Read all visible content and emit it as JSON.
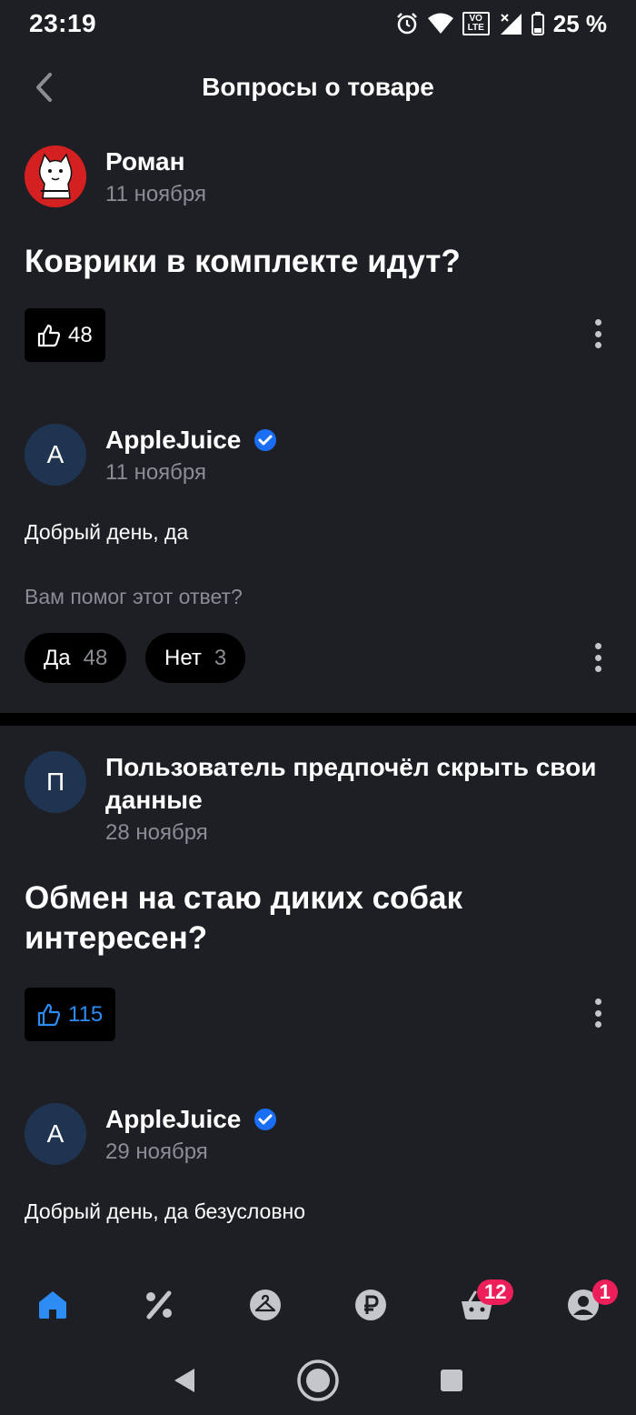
{
  "status": {
    "time": "23:19",
    "battery": "25 %",
    "network_label_top": "VO",
    "network_label_bottom": "LTE"
  },
  "header": {
    "title": "Вопросы о товаре"
  },
  "questions": [
    {
      "author": "Роман",
      "date": "11 ноября",
      "text": "Коврики в комплекте идут?",
      "likes": "48",
      "answer": {
        "avatar_letter": "A",
        "author": "AppleJuice",
        "date": "11 ноября",
        "text": "Добрый день, да",
        "helpful_question": "Вам помог этот ответ?",
        "yes_label": "Да",
        "yes_count": "48",
        "no_label": "Нет",
        "no_count": "3"
      }
    },
    {
      "avatar_letter": "П",
      "author": "Пользователь предпочёл скрыть свои данные",
      "date": "28 ноября",
      "text": "Обмен на стаю диких собак интересен?",
      "likes": "115",
      "answer": {
        "avatar_letter": "A",
        "author": "AppleJuice",
        "date": "29 ноября",
        "text": "Добрый день, да безусловно"
      }
    }
  ],
  "nav": {
    "items": [
      "home-icon",
      "percent-icon",
      "hanger-icon",
      "ruble-icon",
      "basket-icon",
      "profile-icon"
    ],
    "basket_badge": "12",
    "profile_badge": "1",
    "active_color": "#2c8cf4"
  },
  "colors": {
    "background": "#1d1f24",
    "muted": "#8a8d93",
    "accent": "#2c8cf4",
    "badge": "#ec1f5a",
    "verified": "#1a6ef5"
  }
}
